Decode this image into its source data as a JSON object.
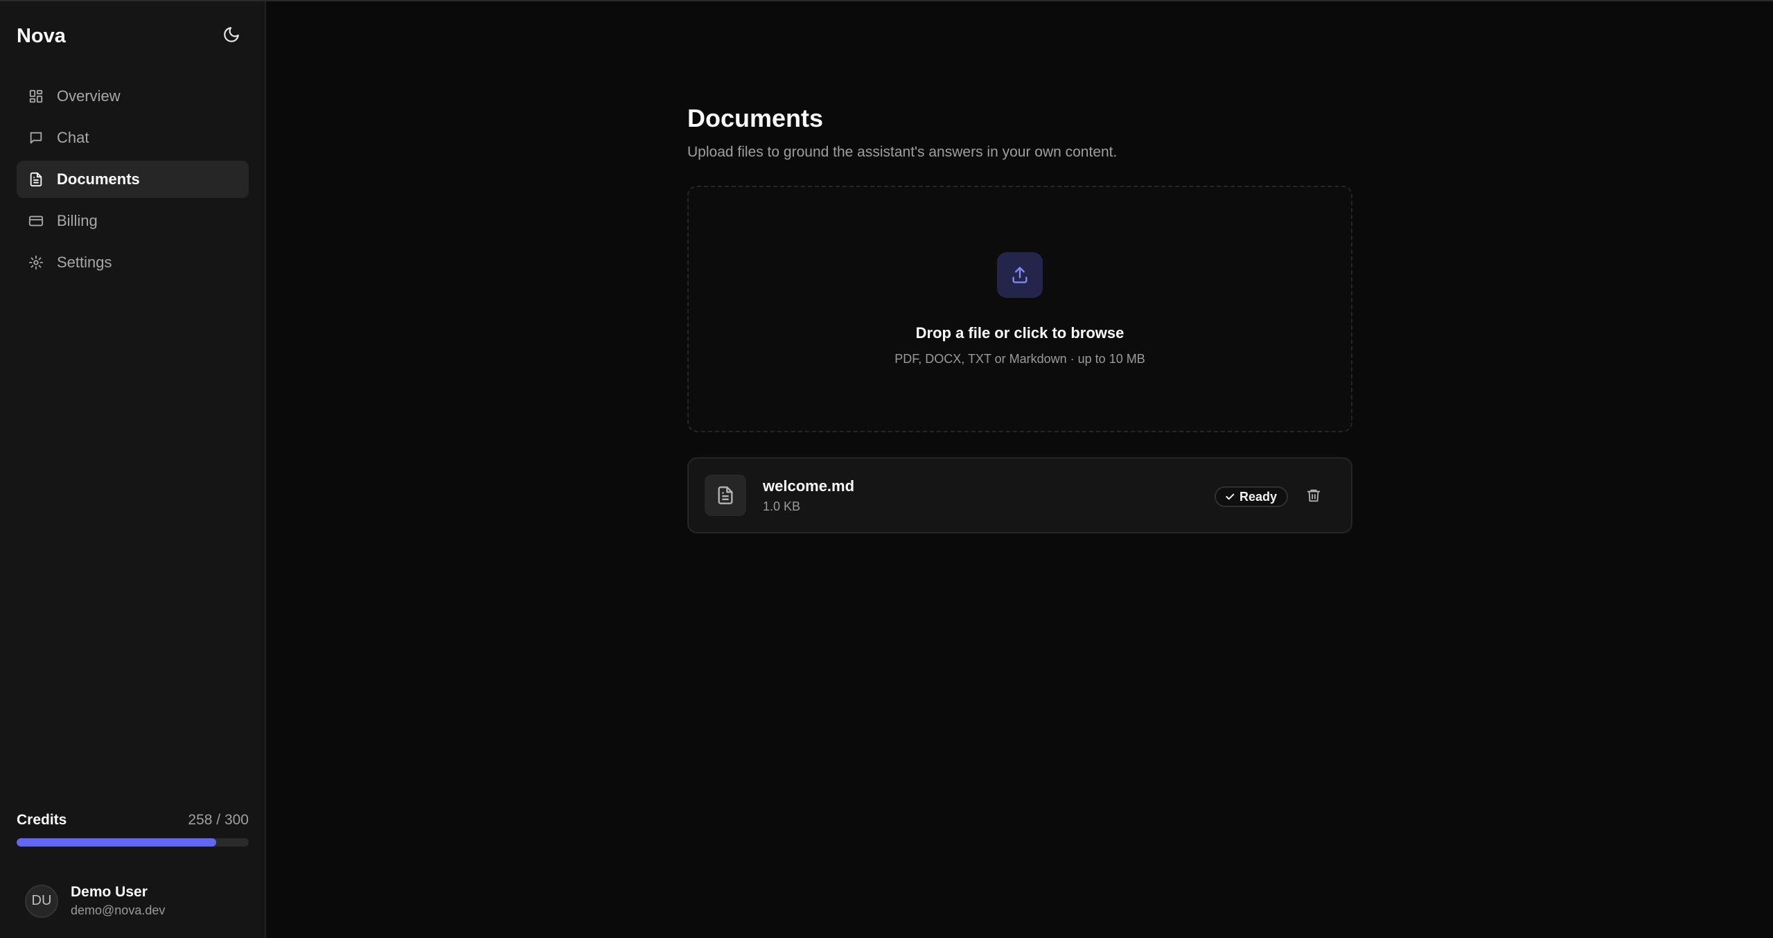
{
  "app": {
    "name": "Nova"
  },
  "sidebar": {
    "items": [
      {
        "label": "Overview",
        "icon": "dashboard-icon",
        "active": false
      },
      {
        "label": "Chat",
        "icon": "chat-icon",
        "active": false
      },
      {
        "label": "Documents",
        "icon": "document-icon",
        "active": true
      },
      {
        "label": "Billing",
        "icon": "credit-card-icon",
        "active": false
      },
      {
        "label": "Settings",
        "icon": "gear-icon",
        "active": false
      }
    ],
    "theme_toggle_icon": "moon-icon",
    "credits": {
      "title": "Credits",
      "value": "258 / 300",
      "used": 258,
      "total": 300
    },
    "user": {
      "initials": "DU",
      "name": "Demo User",
      "email": "demo@nova.dev"
    }
  },
  "main": {
    "title": "Documents",
    "subtitle": "Upload files to ground the assistant's answers in your own content.",
    "dropzone": {
      "title": "Drop a file or click to browse",
      "hint": "PDF, DOCX, TXT or Markdown · up to 10 MB",
      "icon": "upload-icon"
    },
    "files": [
      {
        "name": "welcome.md",
        "size": "1.0 KB",
        "status": "Ready",
        "status_icon": "check-icon",
        "delete_icon": "trash-icon"
      }
    ]
  },
  "colors": {
    "accent": "#6366f1",
    "background": "#0a0a0a",
    "sidebar": "#151515",
    "upload_tile": "#23264a"
  }
}
